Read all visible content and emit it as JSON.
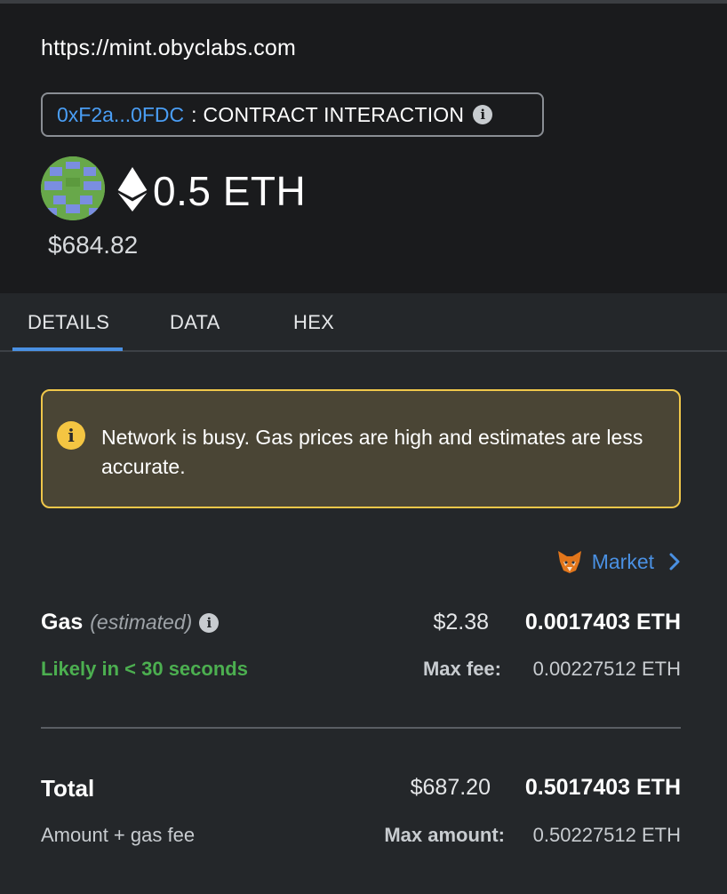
{
  "header": {
    "origin": "https://mint.obyclabs.com",
    "contract_address": "0xF2a...0FDC",
    "separator": ":",
    "contract_type": "CONTRACT INTERACTION",
    "amount": "0.5 ETH",
    "fiat_value": "$684.82"
  },
  "tabs": [
    {
      "label": "DETAILS",
      "active": true
    },
    {
      "label": "DATA",
      "active": false
    },
    {
      "label": "HEX",
      "active": false
    }
  ],
  "warning": {
    "message": "Network is busy. Gas prices are high and estimates are less accurate."
  },
  "gas": {
    "market_label": "Market",
    "label": "Gas",
    "estimated_label": "(estimated)",
    "fiat": "$2.38",
    "eth": "0.0017403 ETH",
    "likely": "Likely in < 30 seconds",
    "max_fee_label": "Max fee:",
    "max_fee_value": "0.00227512 ETH"
  },
  "total": {
    "label": "Total",
    "fiat": "$687.20",
    "eth": "0.5017403 ETH",
    "sub_label": "Amount + gas fee",
    "max_amount_label": "Max amount:",
    "max_amount_value": "0.50227512 ETH"
  },
  "colors": {
    "link": "#4a90e2",
    "success": "#4caf50",
    "warning_border": "#f0c74a",
    "warning_bg": "#4a4535"
  }
}
